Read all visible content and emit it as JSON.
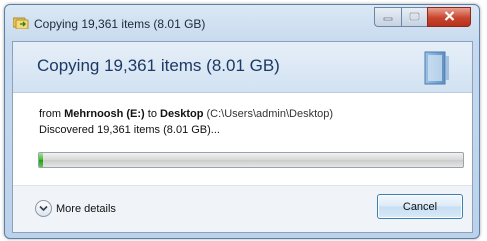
{
  "window": {
    "title": "Copying 19,361 items (8.01 GB)"
  },
  "header": {
    "title": "Copying 19,361 items (8.01 GB)"
  },
  "details": {
    "from_prefix": "from ",
    "source_name": "Mehrnoosh (E:)",
    "to_word": " to ",
    "destination_name": "Desktop",
    "destination_path": " (C:\\Users\\admin\\Desktop)",
    "discovered": "Discovered 19,361 items (8.01 GB)..."
  },
  "progress": {
    "fraction": 0.01,
    "color": "#2fae1c"
  },
  "footer": {
    "more_details_label": "More details",
    "cancel_label": "Cancel"
  },
  "icons": {
    "title": "copy-folder-icon",
    "minimize": "minimize-icon",
    "maximize": "maximize-icon",
    "close": "close-icon",
    "chevron": "chevron-down-icon"
  }
}
